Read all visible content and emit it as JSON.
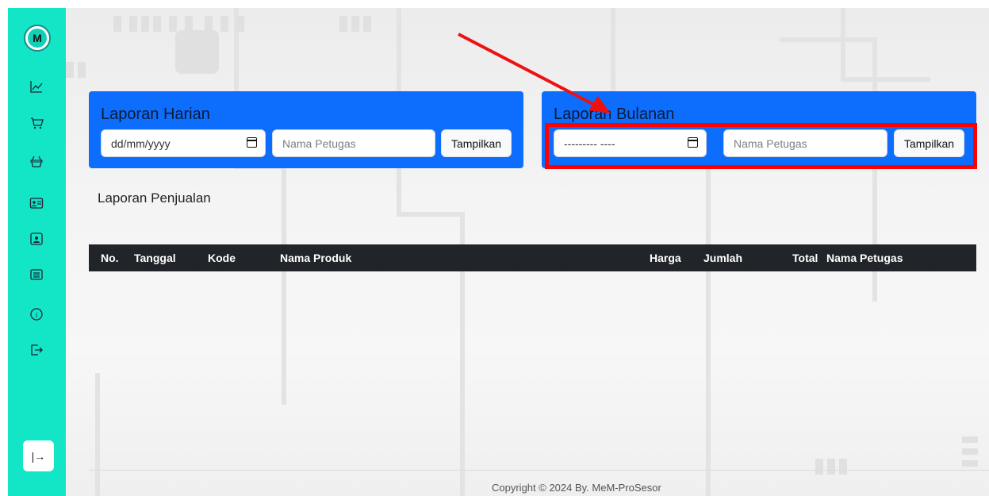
{
  "sidebar": {
    "logo_letter": "M",
    "icons": [
      "chart-line-icon",
      "cart-icon",
      "basket-icon",
      "id-card-icon",
      "person-screen-icon",
      "list-icon",
      "info-icon",
      "logout-icon"
    ],
    "collapse_glyph": "|→"
  },
  "laporan_harian": {
    "title": "Laporan Harian",
    "date_placeholder": "dd/mm/yyyy",
    "petugas_placeholder": "Nama Petugas",
    "button_label": "Tampilkan"
  },
  "laporan_bulanan": {
    "title": "Laporan Bulanan",
    "month_placeholder": "--------- ----",
    "petugas_placeholder": "Nama Petugas",
    "button_label": "Tampilkan"
  },
  "section_title": "Laporan Penjualan",
  "table": {
    "headers": [
      "No.",
      "Tanggal",
      "Kode",
      "Nama Produk",
      "Harga",
      "Jumlah",
      "Total",
      "Nama Petugas"
    ]
  },
  "footer": "Copyright © 2024 By. MeM-ProSesor",
  "colors": {
    "sidebar": "#12e6c6",
    "card": "#0d6efd",
    "table_header": "#212529",
    "annotation": "#ff0000"
  }
}
